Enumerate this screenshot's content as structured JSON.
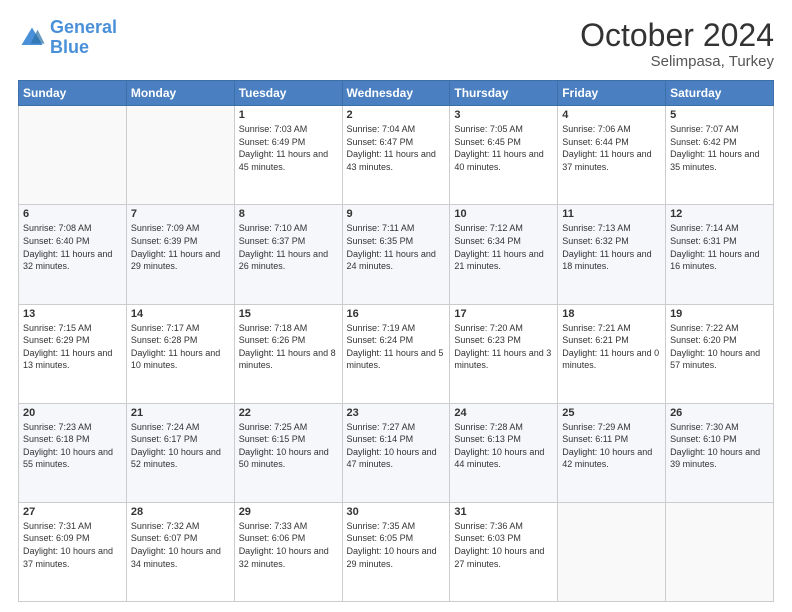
{
  "logo": {
    "line1": "General",
    "line2": "Blue"
  },
  "title": "October 2024",
  "subtitle": "Selimpasa, Turkey",
  "days_header": [
    "Sunday",
    "Monday",
    "Tuesday",
    "Wednesday",
    "Thursday",
    "Friday",
    "Saturday"
  ],
  "weeks": [
    [
      {
        "day": "",
        "info": ""
      },
      {
        "day": "",
        "info": ""
      },
      {
        "day": "1",
        "info": "Sunrise: 7:03 AM\nSunset: 6:49 PM\nDaylight: 11 hours and 45 minutes."
      },
      {
        "day": "2",
        "info": "Sunrise: 7:04 AM\nSunset: 6:47 PM\nDaylight: 11 hours and 43 minutes."
      },
      {
        "day": "3",
        "info": "Sunrise: 7:05 AM\nSunset: 6:45 PM\nDaylight: 11 hours and 40 minutes."
      },
      {
        "day": "4",
        "info": "Sunrise: 7:06 AM\nSunset: 6:44 PM\nDaylight: 11 hours and 37 minutes."
      },
      {
        "day": "5",
        "info": "Sunrise: 7:07 AM\nSunset: 6:42 PM\nDaylight: 11 hours and 35 minutes."
      }
    ],
    [
      {
        "day": "6",
        "info": "Sunrise: 7:08 AM\nSunset: 6:40 PM\nDaylight: 11 hours and 32 minutes."
      },
      {
        "day": "7",
        "info": "Sunrise: 7:09 AM\nSunset: 6:39 PM\nDaylight: 11 hours and 29 minutes."
      },
      {
        "day": "8",
        "info": "Sunrise: 7:10 AM\nSunset: 6:37 PM\nDaylight: 11 hours and 26 minutes."
      },
      {
        "day": "9",
        "info": "Sunrise: 7:11 AM\nSunset: 6:35 PM\nDaylight: 11 hours and 24 minutes."
      },
      {
        "day": "10",
        "info": "Sunrise: 7:12 AM\nSunset: 6:34 PM\nDaylight: 11 hours and 21 minutes."
      },
      {
        "day": "11",
        "info": "Sunrise: 7:13 AM\nSunset: 6:32 PM\nDaylight: 11 hours and 18 minutes."
      },
      {
        "day": "12",
        "info": "Sunrise: 7:14 AM\nSunset: 6:31 PM\nDaylight: 11 hours and 16 minutes."
      }
    ],
    [
      {
        "day": "13",
        "info": "Sunrise: 7:15 AM\nSunset: 6:29 PM\nDaylight: 11 hours and 13 minutes."
      },
      {
        "day": "14",
        "info": "Sunrise: 7:17 AM\nSunset: 6:28 PM\nDaylight: 11 hours and 10 minutes."
      },
      {
        "day": "15",
        "info": "Sunrise: 7:18 AM\nSunset: 6:26 PM\nDaylight: 11 hours and 8 minutes."
      },
      {
        "day": "16",
        "info": "Sunrise: 7:19 AM\nSunset: 6:24 PM\nDaylight: 11 hours and 5 minutes."
      },
      {
        "day": "17",
        "info": "Sunrise: 7:20 AM\nSunset: 6:23 PM\nDaylight: 11 hours and 3 minutes."
      },
      {
        "day": "18",
        "info": "Sunrise: 7:21 AM\nSunset: 6:21 PM\nDaylight: 11 hours and 0 minutes."
      },
      {
        "day": "19",
        "info": "Sunrise: 7:22 AM\nSunset: 6:20 PM\nDaylight: 10 hours and 57 minutes."
      }
    ],
    [
      {
        "day": "20",
        "info": "Sunrise: 7:23 AM\nSunset: 6:18 PM\nDaylight: 10 hours and 55 minutes."
      },
      {
        "day": "21",
        "info": "Sunrise: 7:24 AM\nSunset: 6:17 PM\nDaylight: 10 hours and 52 minutes."
      },
      {
        "day": "22",
        "info": "Sunrise: 7:25 AM\nSunset: 6:15 PM\nDaylight: 10 hours and 50 minutes."
      },
      {
        "day": "23",
        "info": "Sunrise: 7:27 AM\nSunset: 6:14 PM\nDaylight: 10 hours and 47 minutes."
      },
      {
        "day": "24",
        "info": "Sunrise: 7:28 AM\nSunset: 6:13 PM\nDaylight: 10 hours and 44 minutes."
      },
      {
        "day": "25",
        "info": "Sunrise: 7:29 AM\nSunset: 6:11 PM\nDaylight: 10 hours and 42 minutes."
      },
      {
        "day": "26",
        "info": "Sunrise: 7:30 AM\nSunset: 6:10 PM\nDaylight: 10 hours and 39 minutes."
      }
    ],
    [
      {
        "day": "27",
        "info": "Sunrise: 7:31 AM\nSunset: 6:09 PM\nDaylight: 10 hours and 37 minutes."
      },
      {
        "day": "28",
        "info": "Sunrise: 7:32 AM\nSunset: 6:07 PM\nDaylight: 10 hours and 34 minutes."
      },
      {
        "day": "29",
        "info": "Sunrise: 7:33 AM\nSunset: 6:06 PM\nDaylight: 10 hours and 32 minutes."
      },
      {
        "day": "30",
        "info": "Sunrise: 7:35 AM\nSunset: 6:05 PM\nDaylight: 10 hours and 29 minutes."
      },
      {
        "day": "31",
        "info": "Sunrise: 7:36 AM\nSunset: 6:03 PM\nDaylight: 10 hours and 27 minutes."
      },
      {
        "day": "",
        "info": ""
      },
      {
        "day": "",
        "info": ""
      }
    ]
  ]
}
